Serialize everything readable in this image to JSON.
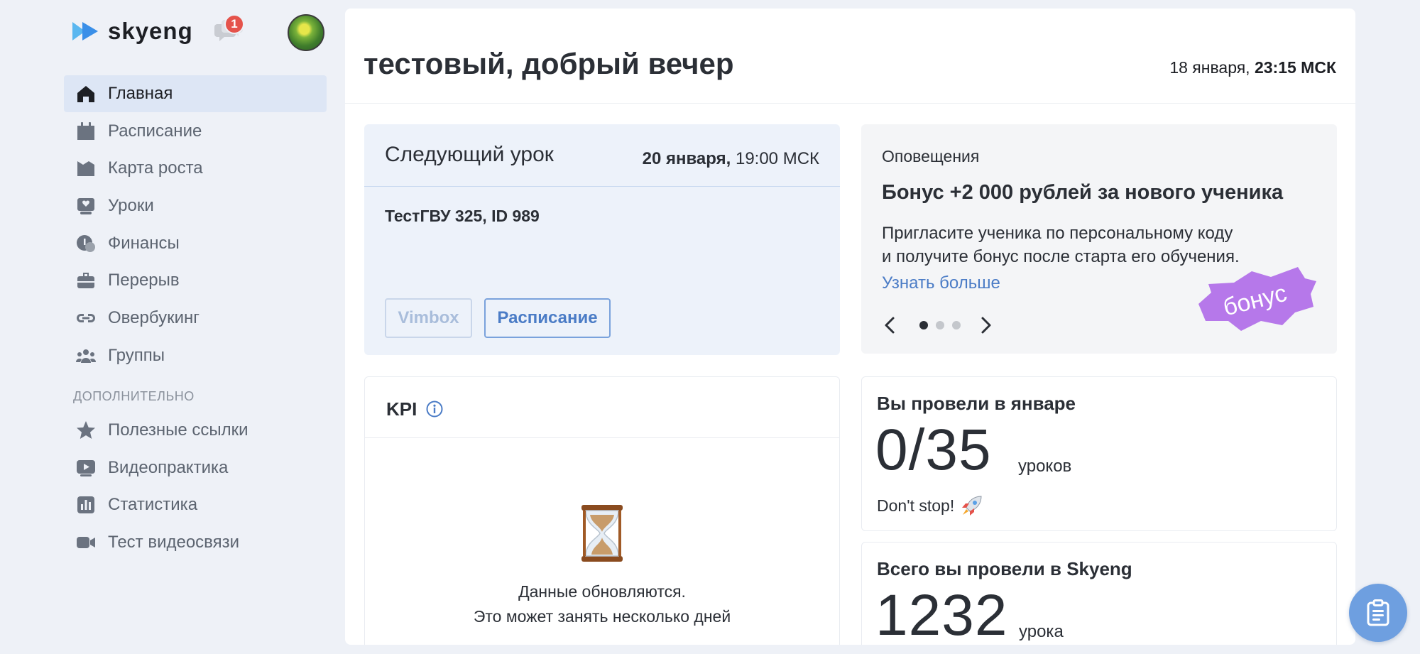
{
  "brand": {
    "name": "skyeng",
    "notifications_count": "1"
  },
  "sidebar": {
    "items": [
      {
        "label": "Главная",
        "icon": "home-icon"
      },
      {
        "label": "Расписание",
        "icon": "calendar-icon"
      },
      {
        "label": "Карта роста",
        "icon": "growth-map-icon"
      },
      {
        "label": "Уроки",
        "icon": "lessons-icon"
      },
      {
        "label": "Финансы",
        "icon": "coins-icon"
      },
      {
        "label": "Перерыв",
        "icon": "suitcase-icon"
      },
      {
        "label": "Овербукинг",
        "icon": "link-icon"
      },
      {
        "label": "Группы",
        "icon": "group-icon"
      }
    ],
    "section_label": "ДОПОЛНИТЕЛЬНО",
    "extra_items": [
      {
        "label": "Полезные ссылки",
        "icon": "star-icon"
      },
      {
        "label": "Видеопрактика",
        "icon": "video-play-icon"
      },
      {
        "label": "Статистика",
        "icon": "statistics-icon"
      },
      {
        "label": "Тест видеосвязи",
        "icon": "camera-icon"
      }
    ]
  },
  "header": {
    "greeting": "тестовый, добрый вечер",
    "date": "18 января,",
    "time": "23:15 МСК"
  },
  "next_lesson": {
    "title": "Следующий урок",
    "date": "20 января,",
    "time": "19:00 МСК",
    "name": "ТестГВУ 325, ID 989",
    "vimbox_label": "Vimbox",
    "schedule_label": "Расписание"
  },
  "notifications": {
    "label": "Оповещения",
    "title": "Бонус +2 000 рублей за нового ученика",
    "text_line1": "Пригласите ученика по персональному коду",
    "text_line2": "и получите бонус после старта его обучения.",
    "link": "Узнать больше",
    "badge": "бонус",
    "slides": 3,
    "active_slide": 1
  },
  "kpi": {
    "title": "KPI",
    "msg_line1": "Данные обновляются.",
    "msg_line2": "Это может занять несколько дней"
  },
  "stats": {
    "month": {
      "title": "Вы провели в январе",
      "value": "0/35",
      "unit": "уроков",
      "footer": "Don't stop!"
    },
    "total": {
      "title": "Всего вы провели в Skyeng",
      "value": "1232",
      "unit": "урока"
    }
  },
  "colors": {
    "accent": "#4b7cc6",
    "badge": "#e5534b",
    "bonus": "#b678ea",
    "fab": "#6e9fe0"
  }
}
